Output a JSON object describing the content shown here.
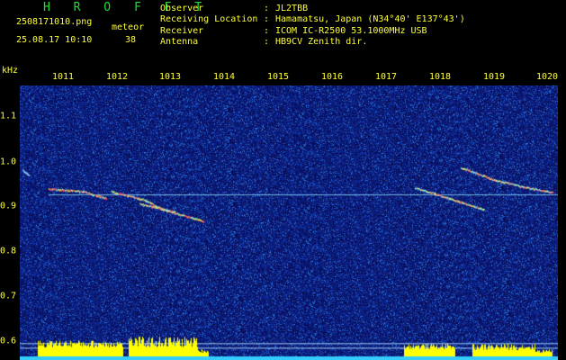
{
  "header": {
    "brand": "H R O F F T",
    "filename": "2508171010.png",
    "meteor_label": "meteor",
    "timestamp": "25.08.17 10:10",
    "meteor_count": "38",
    "info": [
      {
        "label": "Observer",
        "value": "JL2TBB"
      },
      {
        "label": "Receiving Location",
        "value": "Hamamatsu, Japan (N34°40' E137°43')"
      },
      {
        "label": "Receiver",
        "value": "ICOM IC-R2500 53.1000MHz USB"
      },
      {
        "label": "Antenna",
        "value": "HB9CV Zenith dir."
      }
    ]
  },
  "plot": {
    "y_unit": "kHz",
    "x_ticks": [
      "1011",
      "1012",
      "1013",
      "1014",
      "1015",
      "1016",
      "1017",
      "1018",
      "1019",
      "1020"
    ],
    "y_ticks": [
      "1.1",
      "1.0",
      "0.9",
      "0.8",
      "0.7",
      "0.6"
    ],
    "x_range": [
      1010.7,
      1020.1
    ],
    "y_range": [
      0.573,
      1.178
    ],
    "carrier_khz": 0.937,
    "noise_band_khz": [
      0.61,
      0.6
    ],
    "colors": {
      "background": "#0a1a66",
      "text": "#ffff33",
      "brand": "#22dd33",
      "carrier": "#8fdfff",
      "amplitude": "#ffff00",
      "baseline": "#33ccff"
    },
    "traces": [
      {
        "pts": [
          [
            1011.2,
            0.951
          ],
          [
            1011.8,
            0.945
          ],
          [
            1012.2,
            0.93
          ]
        ],
        "intensity": "high"
      },
      {
        "pts": [
          [
            1012.3,
            0.945
          ],
          [
            1012.9,
            0.925
          ],
          [
            1013.2,
            0.905
          ],
          [
            1013.9,
            0.88
          ]
        ],
        "intensity": "high"
      },
      {
        "pts": [
          [
            1012.8,
            0.918
          ],
          [
            1013.4,
            0.9
          ]
        ],
        "intensity": "med"
      },
      {
        "pts": [
          [
            1017.6,
            0.953
          ],
          [
            1017.95,
            0.94
          ],
          [
            1018.2,
            0.93
          ],
          [
            1018.8,
            0.905
          ]
        ],
        "intensity": "med"
      },
      {
        "pts": [
          [
            1018.4,
            0.998
          ],
          [
            1019.0,
            0.97
          ],
          [
            1019.5,
            0.955
          ],
          [
            1020.0,
            0.943
          ]
        ],
        "intensity": "med"
      },
      {
        "pts": [
          [
            1010.75,
            0.992
          ],
          [
            1010.85,
            0.98
          ]
        ],
        "intensity": "low"
      }
    ]
  }
}
